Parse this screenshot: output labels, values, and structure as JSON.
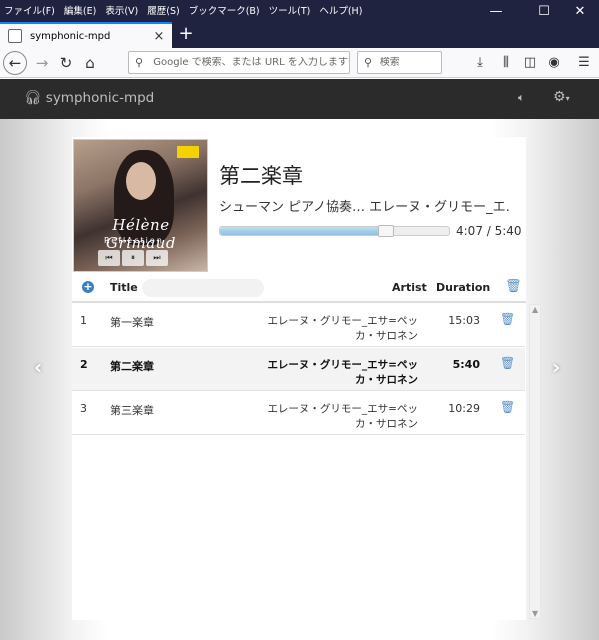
{
  "menu": [
    "ファイル(F)",
    "編集(E)",
    "表示(V)",
    "履歴(S)",
    "ブックマーク(B)",
    "ツール(T)",
    "ヘルプ(H)"
  ],
  "window": {
    "minimize": "—",
    "maximize": "☐",
    "close": "✕"
  },
  "tab": {
    "title": "symphonic-mpd",
    "close": "×",
    "new_tab": "+"
  },
  "nav": {
    "url_placeholder": "Google で検索、または URL を入力します",
    "search_placeholder": "検索"
  },
  "app": {
    "brand": "symphonic-mpd",
    "icons": [
      "headphones-icon",
      "volume-icon",
      "gear-icon"
    ]
  },
  "now_playing": {
    "title": "第二楽章",
    "subtitle": "シューマン ピアノ協奏… エレーヌ・グリモー_エ…",
    "elapsed": "4:07",
    "total": "5:40",
    "time_display": "4:07 / 5:40",
    "progress": 0.726
  },
  "album_art": {
    "artist_script": "Hélène Grimaud",
    "album_name": "Reflection"
  },
  "playlist": {
    "headers": {
      "title": "Title",
      "artist": "Artist",
      "duration": "Duration"
    },
    "rows": [
      {
        "num": "1",
        "title": "第一楽章",
        "artist": "エレーヌ・グリモー_エサ=ペッカ・サロネン",
        "duration": "15:03",
        "current": false
      },
      {
        "num": "2",
        "title": "第二楽章",
        "artist": "エレーヌ・グリモー_エサ=ペッカ・サロネン",
        "duration": "5:40",
        "current": true
      },
      {
        "num": "3",
        "title": "第三楽章",
        "artist": "エレーヌ・グリモー_エサ=ペッカ・サロネン",
        "duration": "10:29",
        "current": false
      }
    ]
  },
  "colors": {
    "header_bg": "#2b2b2b",
    "accent": "#3b7fc4",
    "titlebar": "#202340"
  }
}
